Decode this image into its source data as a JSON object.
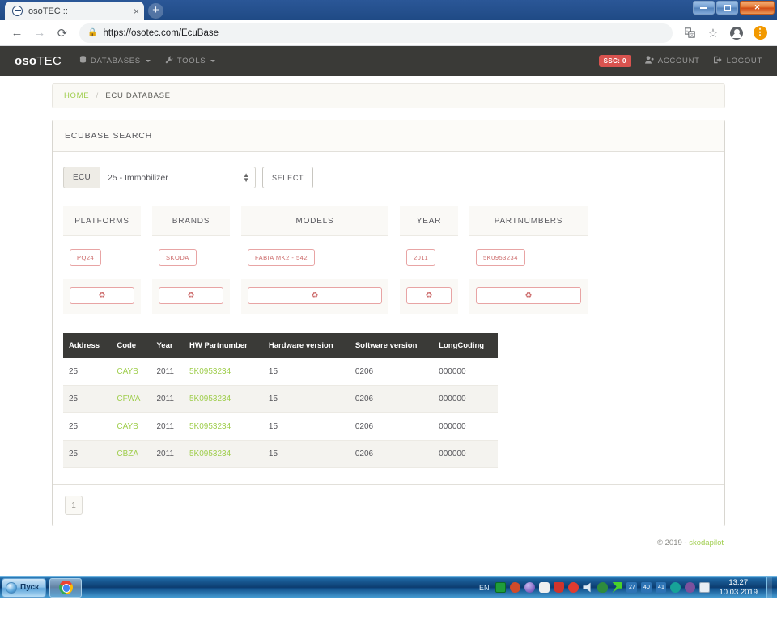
{
  "browser": {
    "tab_title": "osoTEC ::",
    "tab_close": "×",
    "newtab_label": "+",
    "back": "←",
    "forward": "→",
    "reload": "⟳",
    "lock_icon": "🔒",
    "url": "https://osotec.com/EcuBase",
    "translate_icon": "translate-icon",
    "bookmark_star": "☆",
    "profile_icon": "profile-avatar",
    "menu_badge": "⋮",
    "minimize": "–",
    "maximize": "❐",
    "close": "✕"
  },
  "appnav": {
    "brand_bold": "oso",
    "brand_light": "TEC",
    "items": [
      {
        "label": "DATABASES",
        "icon": "database-icon",
        "icon_glyph": "⛁"
      },
      {
        "label": "TOOLS",
        "icon": "wrench-icon",
        "icon_glyph": "🔧"
      }
    ],
    "ssc_badge": "SSC: 0",
    "account": "ACCOUNT",
    "account_icon": "user-icon",
    "logout": "LOGOUT",
    "logout_icon": "logout-icon"
  },
  "breadcrumb": {
    "home": "HOME",
    "separator": "/",
    "current": "ECU DATABASE"
  },
  "panel": {
    "title": "ECUBASE SEARCH"
  },
  "ecu": {
    "label": "ECU",
    "selected": "25 - Immobilizer",
    "select_button": "SELECT"
  },
  "filters": [
    {
      "title": "PLATFORMS",
      "tags": [
        "PQ24"
      ],
      "reset_icon": "♻"
    },
    {
      "title": "BRANDS",
      "tags": [
        "SKODA"
      ],
      "reset_icon": "♻"
    },
    {
      "title": "MODELS",
      "tags": [
        "FABIA MK2 - 542"
      ],
      "reset_icon": "♻"
    },
    {
      "title": "YEAR",
      "tags": [
        "2011"
      ],
      "reset_icon": "♻"
    },
    {
      "title": "PARTNUMBERS",
      "tags": [
        "5K0953234"
      ],
      "reset_icon": "♻"
    }
  ],
  "table": {
    "columns": [
      "Address",
      "Code",
      "Year",
      "HW Partnumber",
      "Hardware version",
      "Software version",
      "LongCoding"
    ],
    "rows": [
      {
        "address": "25",
        "code": "CAYB",
        "year": "2011",
        "hw_partnumber": "5K0953234",
        "hardware_version": "15",
        "software_version": "0206",
        "longcoding": "000000"
      },
      {
        "address": "25",
        "code": "CFWA",
        "year": "2011",
        "hw_partnumber": "5K0953234",
        "hardware_version": "15",
        "software_version": "0206",
        "longcoding": "000000"
      },
      {
        "address": "25",
        "code": "CAYB",
        "year": "2011",
        "hw_partnumber": "5K0953234",
        "hardware_version": "15",
        "software_version": "0206",
        "longcoding": "000000"
      },
      {
        "address": "25",
        "code": "CBZA",
        "year": "2011",
        "hw_partnumber": "5K0953234",
        "hardware_version": "15",
        "software_version": "0206",
        "longcoding": "000000"
      }
    ]
  },
  "pagination": {
    "current_page": "1"
  },
  "footer": {
    "copyright": "© 2019 -",
    "site": "skodapilot"
  },
  "taskbar": {
    "start_label": "Пуск",
    "app_chrome": "chrome-icon",
    "lang": "EN",
    "time": "13:27",
    "date": "10.03.2019"
  },
  "colors": {
    "nav_bg": "#3a3a37",
    "accent_green": "#a0ce4e",
    "tag_red": "#cc6a6a",
    "badge_red": "#d9534f"
  }
}
